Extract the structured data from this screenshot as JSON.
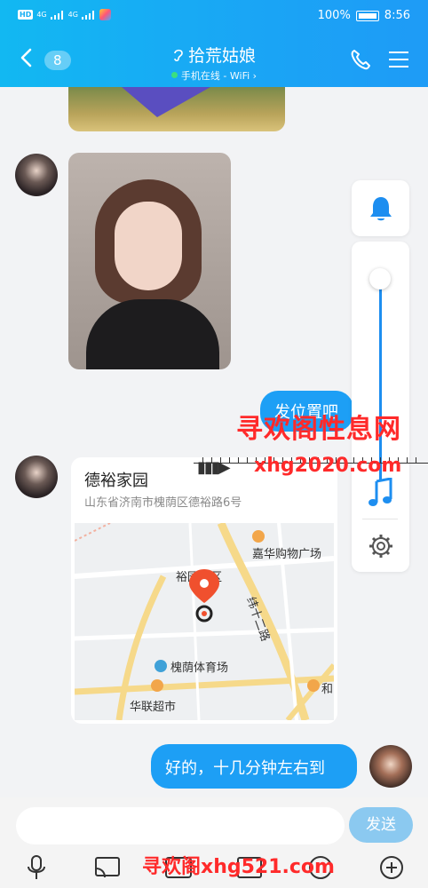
{
  "status_bar": {
    "hd": "HD",
    "net1": "4G",
    "net2": "4G",
    "battery_percent": "100%",
    "time": "8:56"
  },
  "header": {
    "back_badge": "8",
    "title": "拾荒姑娘",
    "status": "手机在线 - WiFi",
    "status_chevron": "›"
  },
  "messages": {
    "location_request": "发位置吧",
    "location_card": {
      "name": "德裕家园",
      "address": "山东省济南市槐荫区德裕路6号",
      "map_labels": {
        "mall": "嘉华购物广场",
        "district": "裕园小区",
        "road": "纬十二路",
        "stadium": "槐荫体育场",
        "market": "华联超市",
        "right_edge": "和"
      }
    },
    "reply": "好的，十几分钟左右到"
  },
  "watermarks": {
    "line1": "寻欢阁性息网",
    "line2": "xhg2020.com",
    "line3": "寻欢阁xhg521.com"
  },
  "input": {
    "send_label": "发送"
  },
  "icons": {
    "bell": "bell-icon",
    "music": "music-note-icon",
    "settings": "gear-icon"
  },
  "colors": {
    "header_gradient_start": "#12b8f2",
    "bubble_out": "#1d9ff5",
    "send_button": "#8bc9f0",
    "accent": "#1d8ef0"
  }
}
